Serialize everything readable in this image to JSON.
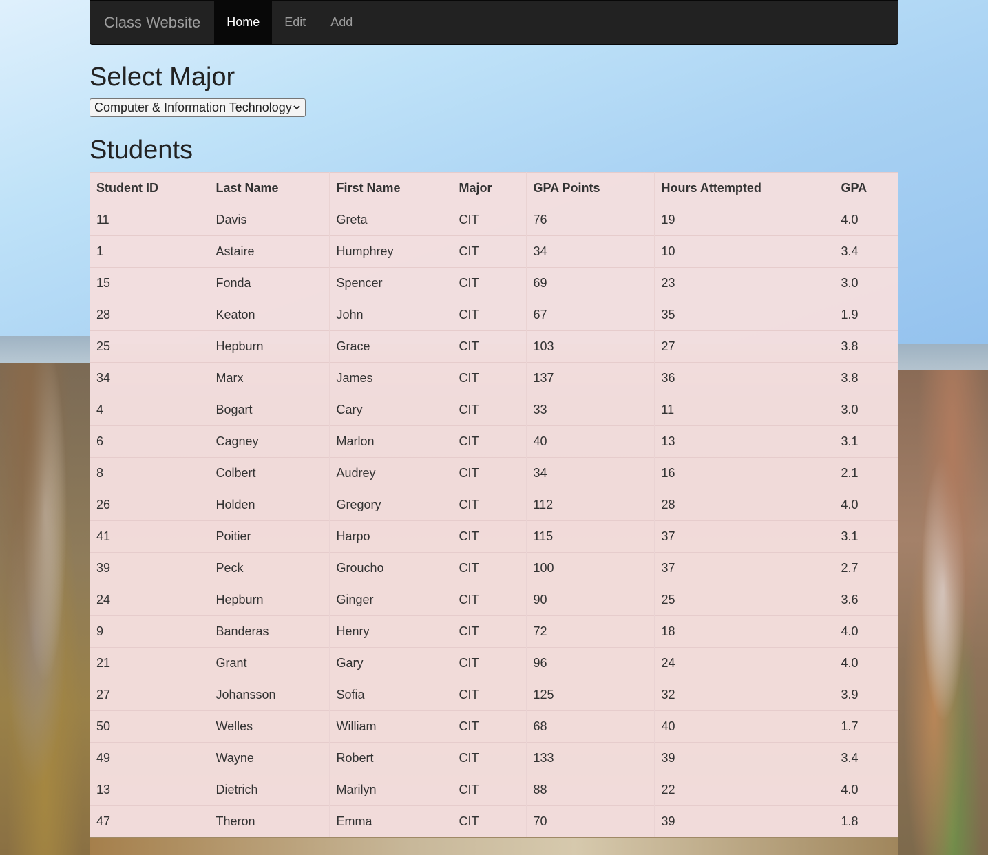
{
  "navbar": {
    "brand": "Class Website",
    "items": [
      {
        "label": "Home",
        "active": true
      },
      {
        "label": "Edit",
        "active": false
      },
      {
        "label": "Add",
        "active": false
      }
    ]
  },
  "major_section": {
    "title": "Select Major",
    "selected": "Computer & Information Technology"
  },
  "students_section": {
    "title": "Students",
    "columns": [
      "Student ID",
      "Last Name",
      "First Name",
      "Major",
      "GPA Points",
      "Hours Attempted",
      "GPA"
    ],
    "rows": [
      [
        "11",
        "Davis",
        "Greta",
        "CIT",
        "76",
        "19",
        "4.0"
      ],
      [
        "1",
        "Astaire",
        "Humphrey",
        "CIT",
        "34",
        "10",
        "3.4"
      ],
      [
        "15",
        "Fonda",
        "Spencer",
        "CIT",
        "69",
        "23",
        "3.0"
      ],
      [
        "28",
        "Keaton",
        "John",
        "CIT",
        "67",
        "35",
        "1.9"
      ],
      [
        "25",
        "Hepburn",
        "Grace",
        "CIT",
        "103",
        "27",
        "3.8"
      ],
      [
        "34",
        "Marx",
        "James",
        "CIT",
        "137",
        "36",
        "3.8"
      ],
      [
        "4",
        "Bogart",
        "Cary",
        "CIT",
        "33",
        "11",
        "3.0"
      ],
      [
        "6",
        "Cagney",
        "Marlon",
        "CIT",
        "40",
        "13",
        "3.1"
      ],
      [
        "8",
        "Colbert",
        "Audrey",
        "CIT",
        "34",
        "16",
        "2.1"
      ],
      [
        "26",
        "Holden",
        "Gregory",
        "CIT",
        "112",
        "28",
        "4.0"
      ],
      [
        "41",
        "Poitier",
        "Harpo",
        "CIT",
        "115",
        "37",
        "3.1"
      ],
      [
        "39",
        "Peck",
        "Groucho",
        "CIT",
        "100",
        "37",
        "2.7"
      ],
      [
        "24",
        "Hepburn",
        "Ginger",
        "CIT",
        "90",
        "25",
        "3.6"
      ],
      [
        "9",
        "Banderas",
        "Henry",
        "CIT",
        "72",
        "18",
        "4.0"
      ],
      [
        "21",
        "Grant",
        "Gary",
        "CIT",
        "96",
        "24",
        "4.0"
      ],
      [
        "27",
        "Johansson",
        "Sofia",
        "CIT",
        "125",
        "32",
        "3.9"
      ],
      [
        "50",
        "Welles",
        "William",
        "CIT",
        "68",
        "40",
        "1.7"
      ],
      [
        "49",
        "Wayne",
        "Robert",
        "CIT",
        "133",
        "39",
        "3.4"
      ],
      [
        "13",
        "Dietrich",
        "Marilyn",
        "CIT",
        "88",
        "22",
        "4.0"
      ],
      [
        "47",
        "Theron",
        "Emma",
        "CIT",
        "70",
        "39",
        "1.8"
      ]
    ]
  },
  "icons": {
    "dropdown": "chevron-down-icon"
  }
}
